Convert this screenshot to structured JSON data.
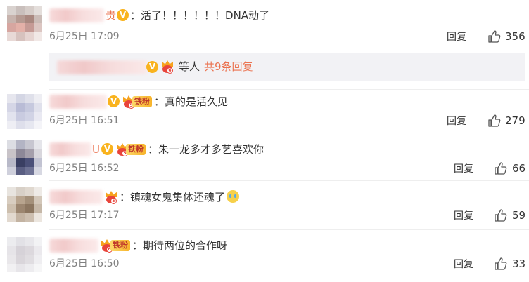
{
  "comments": [
    {
      "name_tail": "贵",
      "text": "活了！！！！！！DNA动了",
      "time": "6月25日 17:09",
      "reply": "回复",
      "likes": "356"
    },
    {
      "text": "真的是活久见",
      "fan": "铁粉",
      "time": "6月25日 16:51",
      "reply": "回复",
      "likes": "279"
    },
    {
      "name_tail": "U",
      "text": "朱一龙多才多艺喜欢你",
      "fan": "铁粉",
      "time": "6月25日 16:52",
      "reply": "回复",
      "likes": "66"
    },
    {
      "text": "镇魂女鬼集体还魂了",
      "time": "6月25日 17:17",
      "reply": "回复",
      "likes": "59"
    },
    {
      "text": "期待两位的合作呀",
      "fan": "铁粉",
      "time": "6月25日 16:50",
      "reply": "回复",
      "likes": "33"
    }
  ],
  "sub_reply": {
    "suffix": "等人",
    "more": "共9条回复"
  },
  "colors": {
    "accent": "#eb7350",
    "verified": "#f9b31e",
    "meta": "#808080"
  },
  "icons": {
    "like": "thumbs-up-icon",
    "verified": "verified-v-icon",
    "crown": "crown-badge-icon",
    "emoji": "crying-emoji-icon"
  }
}
